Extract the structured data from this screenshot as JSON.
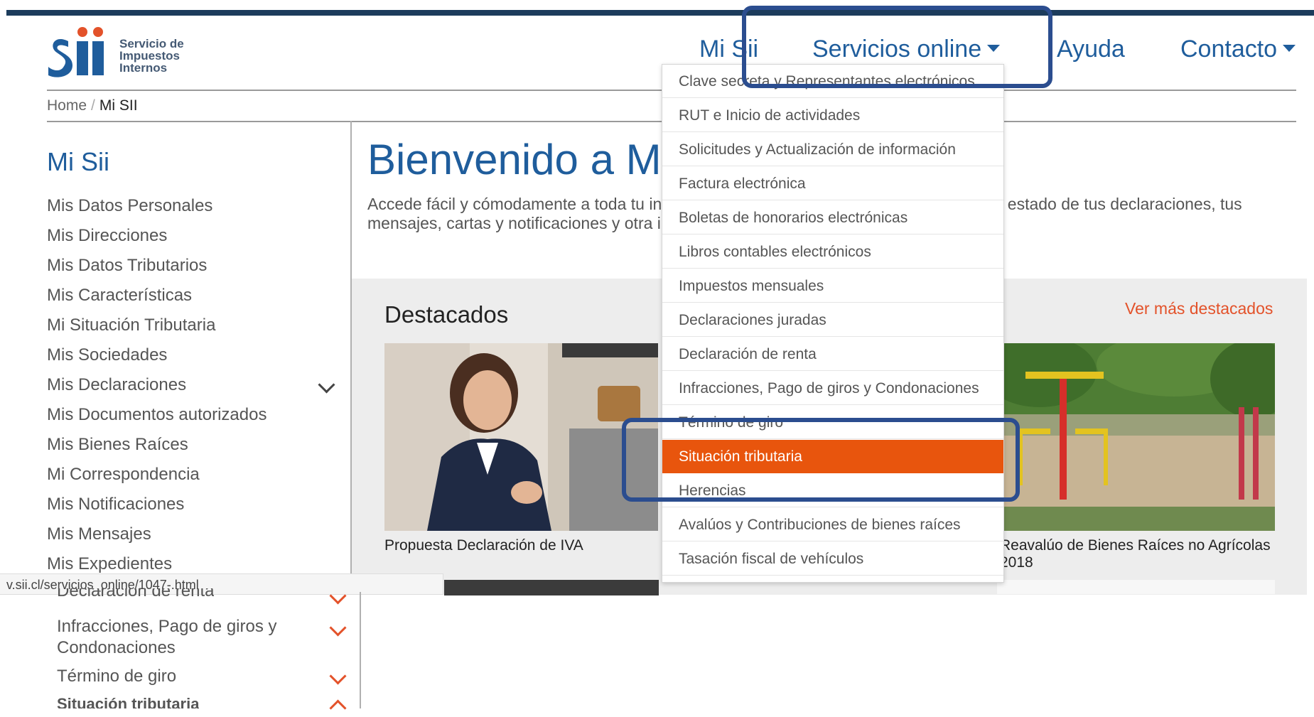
{
  "header": {
    "logo": {
      "mark": "Sii",
      "lines": [
        "Servicio de",
        "Impuestos",
        "Internos"
      ]
    },
    "nav": [
      {
        "label": "Mi Sii"
      },
      {
        "label": "Servicios online"
      },
      {
        "label": "Ayuda"
      },
      {
        "label": "Contacto"
      }
    ]
  },
  "breadcrumb": {
    "home": "Home",
    "separator": "/",
    "current": "Mi SII"
  },
  "sidebar": {
    "title": "Mi Sii",
    "items": [
      "Mis Datos Personales",
      "Mis Direcciones",
      "Mis Datos Tributarios",
      "Mis Características",
      "Mi Situación Tributaria",
      "Mis Sociedades",
      "Mis Declaraciones",
      "Mis Documentos autorizados",
      "Mis Bienes Raíces",
      "Mi Correspondencia",
      "Mis Notificaciones",
      "Mis Mensajes",
      "Mis Expedientes"
    ]
  },
  "main": {
    "welcome": "Bienvenido a M",
    "intro_line1": "Accede fácil y cómodamente a toda tu in",
    "intro_line2": "mensajes, cartas y notificaciones y otra i",
    "intro_right": ", estado de tus declaraciones, tus",
    "featured_title": "Destacados",
    "see_more": "Ver más destacados",
    "cards": [
      {
        "caption": "Propuesta Declaración de IVA"
      },
      {
        "caption": "Reavalúo de Bienes Raíces no Agrícolas 2018"
      }
    ]
  },
  "dropdown": {
    "items": [
      "Clave secreta y Representantes electrónicos",
      "RUT e Inicio de actividades",
      "Solicitudes y Actualización de información",
      "Factura electrónica",
      "Boletas de honorarios electrónicas",
      "Libros contables electrónicos",
      "Impuestos mensuales",
      "Declaraciones juradas",
      "Declaración de renta",
      "Infracciones, Pago de giros y Condonaciones",
      "Término de giro",
      "Situación tributaria",
      "Herencias",
      "Avalúos y Contribuciones de bienes raíces",
      "Tasación fiscal de vehículos"
    ],
    "active_item": "Situación tributaria"
  },
  "statusbar": {
    "url": "v.sii.cl/servicios_online/1047-.html"
  },
  "lower_sidebar": {
    "partial_item": "Declaración de renta",
    "item1_line1": "Infracciones, Pago de giros y",
    "item1_line2": "Condonaciones",
    "item2": "Término de giro",
    "item3": "Situación tributaria"
  },
  "colors": {
    "brand_blue": "#1f5d9c",
    "accent_orange": "#e8550d",
    "highlight_box": "#2b4d8f",
    "logo_red": "#e3522a"
  }
}
